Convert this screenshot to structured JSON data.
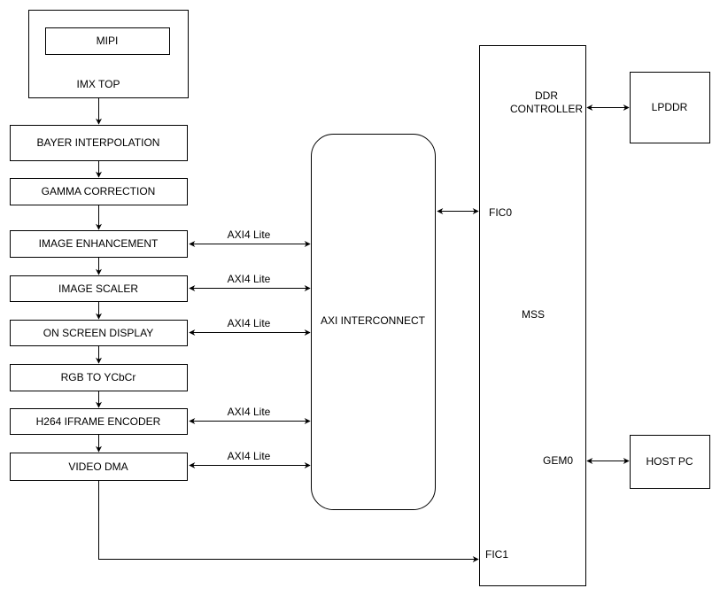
{
  "blocks": {
    "imx_top": "IMX TOP",
    "mipi": "MIPI",
    "bayer": "BAYER INTERPOLATION",
    "gamma": "GAMMA CORRECTION",
    "enhancement": "IMAGE ENHANCEMENT",
    "scaler": "IMAGE SCALER",
    "osd": "ON SCREEN DISPLAY",
    "rgb": "RGB TO YCbCr",
    "h264": "H264 IFRAME ENCODER",
    "vdma": "VIDEO DMA",
    "axi": "AXI INTERCONNECT",
    "mss": "MSS",
    "lpddr": "LPDDR",
    "host": "HOST PC"
  },
  "ports": {
    "ddr_line1": "DDR",
    "ddr_line2": "CONTROLLER",
    "fic0": "FIC0",
    "fic1": "FIC1",
    "gem0": "GEM0"
  },
  "links": {
    "axi_label": "AXI4 Lite"
  }
}
